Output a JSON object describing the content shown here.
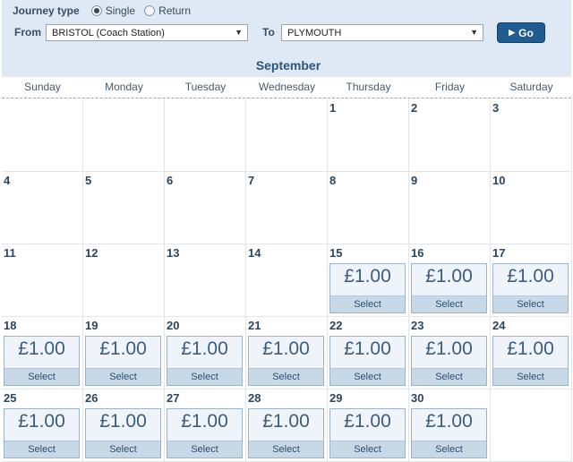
{
  "journey": {
    "label": "Journey type",
    "options": [
      {
        "label": "Single",
        "selected": true
      },
      {
        "label": "Return",
        "selected": false
      }
    ]
  },
  "route": {
    "from_label": "From",
    "from_value": "BRISTOL (Coach Station)",
    "to_label": "To",
    "to_value": "PLYMOUTH",
    "go_label": "Go"
  },
  "calendar": {
    "month": "September",
    "weekdays": [
      "Sunday",
      "Monday",
      "Tuesday",
      "Wednesday",
      "Thursday",
      "Friday",
      "Saturday"
    ],
    "weeks": [
      [
        null,
        null,
        null,
        null,
        {
          "day": "1"
        },
        {
          "day": "2"
        },
        {
          "day": "3"
        }
      ],
      [
        {
          "day": "4"
        },
        {
          "day": "5"
        },
        {
          "day": "6"
        },
        {
          "day": "7"
        },
        {
          "day": "8"
        },
        {
          "day": "9"
        },
        {
          "day": "10"
        }
      ],
      [
        {
          "day": "11"
        },
        {
          "day": "12"
        },
        {
          "day": "13"
        },
        {
          "day": "14"
        },
        {
          "day": "15",
          "price": "£1.00",
          "action": "Select"
        },
        {
          "day": "16",
          "price": "£1.00",
          "action": "Select"
        },
        {
          "day": "17",
          "price": "£1.00",
          "action": "Select"
        }
      ],
      [
        {
          "day": "18",
          "price": "£1.00",
          "action": "Select"
        },
        {
          "day": "19",
          "price": "£1.00",
          "action": "Select"
        },
        {
          "day": "20",
          "price": "£1.00",
          "action": "Select"
        },
        {
          "day": "21",
          "price": "£1.00",
          "action": "Select"
        },
        {
          "day": "22",
          "price": "£1.00",
          "action": "Select"
        },
        {
          "day": "23",
          "price": "£1.00",
          "action": "Select"
        },
        {
          "day": "24",
          "price": "£1.00",
          "action": "Select"
        }
      ],
      [
        {
          "day": "25",
          "price": "£1.00",
          "action": "Select"
        },
        {
          "day": "26",
          "price": "£1.00",
          "action": "Select"
        },
        {
          "day": "27",
          "price": "£1.00",
          "action": "Select"
        },
        {
          "day": "28",
          "price": "£1.00",
          "action": "Select"
        },
        {
          "day": "29",
          "price": "£1.00",
          "action": "Select"
        },
        {
          "day": "30",
          "price": "£1.00",
          "action": "Select"
        },
        null
      ]
    ]
  }
}
